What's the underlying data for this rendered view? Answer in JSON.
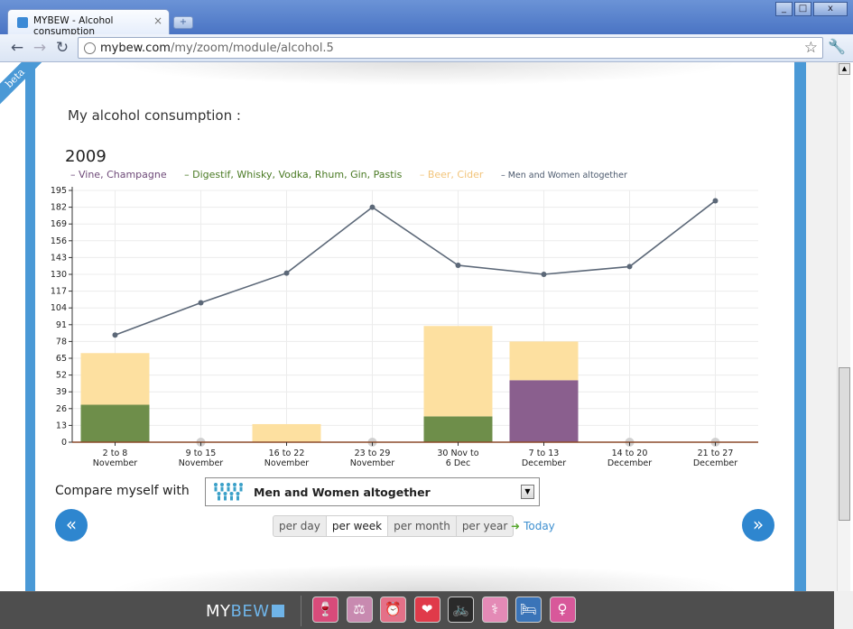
{
  "browser": {
    "tab_title": "MYBEW - Alcohol consumption",
    "url_host": "mybew.com",
    "url_path": "/my/zoom/module/alcohol.5"
  },
  "page": {
    "beta": "beta",
    "title": "My alcohol consumption :",
    "year": "2009"
  },
  "legend": {
    "wine": "Vine, Champagne",
    "spirits": "Digestif, Whisky, Vodka, Rhum, Gin, Pastis",
    "beer": "Beer, Cider",
    "all": "Men and Women altogether"
  },
  "chart_data": {
    "type": "bar",
    "categories": [
      [
        "2 to 8",
        "November"
      ],
      [
        "9 to 15",
        "November"
      ],
      [
        "16 to 22",
        "November"
      ],
      [
        "23 to 29",
        "November"
      ],
      [
        "30 Nov to",
        "6 Dec"
      ],
      [
        "7 to 13",
        "December"
      ],
      [
        "14 to 20",
        "December"
      ],
      [
        "21 to 27",
        "December"
      ]
    ],
    "series": [
      {
        "name": "Vine, Champagne",
        "values": [
          0,
          0,
          0,
          0,
          0,
          48,
          0,
          0
        ],
        "color": "#8a5f8e"
      },
      {
        "name": "Digestif, Whisky, Vodka, Rhum, Gin, Pastis",
        "values": [
          29,
          0,
          0,
          0,
          20,
          0,
          0,
          0
        ],
        "color": "#6e8e4a"
      },
      {
        "name": "Beer, Cider",
        "values": [
          40,
          0,
          14,
          0,
          70,
          30,
          0,
          0
        ],
        "color": "#fde0a0"
      },
      {
        "name": "Men and Women altogether",
        "values": [
          83,
          108,
          131,
          182,
          137,
          130,
          136,
          187
        ],
        "color": "#5c6878"
      }
    ],
    "y_ticks": [
      0,
      13,
      26,
      39,
      52,
      65,
      78,
      91,
      104,
      117,
      130,
      143,
      156,
      169,
      182,
      195
    ],
    "ylim": [
      0,
      195
    ],
    "grid": true,
    "legend_position": "top"
  },
  "compare": {
    "label": "Compare myself with",
    "value": "Men and Women altogether"
  },
  "periods": [
    "per day",
    "per week",
    "per month",
    "per year"
  ],
  "active_period": "per week",
  "today": "Today",
  "nav": {
    "prev": "«",
    "next": "»"
  },
  "dock": {
    "logo_my": "MY",
    "logo_bew": "BEW",
    "modules": [
      {
        "name": "alcohol-icon",
        "glyph": "🍷",
        "color": "#d84b7a"
      },
      {
        "name": "weight-icon",
        "glyph": "⚖",
        "color": "#c88ab0"
      },
      {
        "name": "alarm-clock-icon",
        "glyph": "⏰",
        "color": "#e47088"
      },
      {
        "name": "heart-icon",
        "glyph": "❤",
        "color": "#e03a4a"
      },
      {
        "name": "cycling-icon",
        "glyph": "🚲",
        "color": "#2a2a2a"
      },
      {
        "name": "cigarette-icon",
        "glyph": "⚕",
        "color": "#e48ab6"
      },
      {
        "name": "sleep-icon",
        "glyph": "🛏",
        "color": "#3a74b8"
      },
      {
        "name": "female-icon",
        "glyph": "♀",
        "color": "#d8589a"
      }
    ]
  }
}
